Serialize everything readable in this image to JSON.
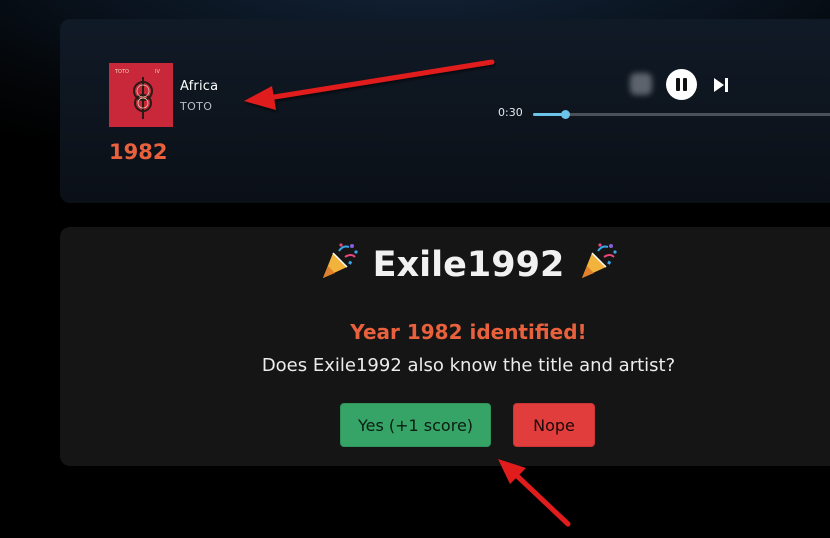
{
  "player": {
    "track_title": "Africa",
    "track_artist": "TOTO",
    "track_year": "1982",
    "album_art_label": "TOTO IV",
    "elapsed": "0:30",
    "progress_fraction": 0.1
  },
  "result": {
    "player_name": "Exile1992",
    "identified_message": "Year 1982 identified!",
    "question": "Does Exile1992 also know the title and artist?",
    "yes_label": "Yes (+1 score)",
    "nope_label": "Nope"
  },
  "colors": {
    "accent_orange": "#e8613c",
    "progress_blue": "#6cc5e8",
    "yes_green": "#35a466",
    "nope_red": "#e23d3d",
    "annotation_red": "#e01b1b"
  },
  "icons": {
    "previous": "blurred-previous-icon",
    "pause": "pause-icon",
    "next": "skip-next-icon",
    "celebration": "party-popper-icon"
  }
}
